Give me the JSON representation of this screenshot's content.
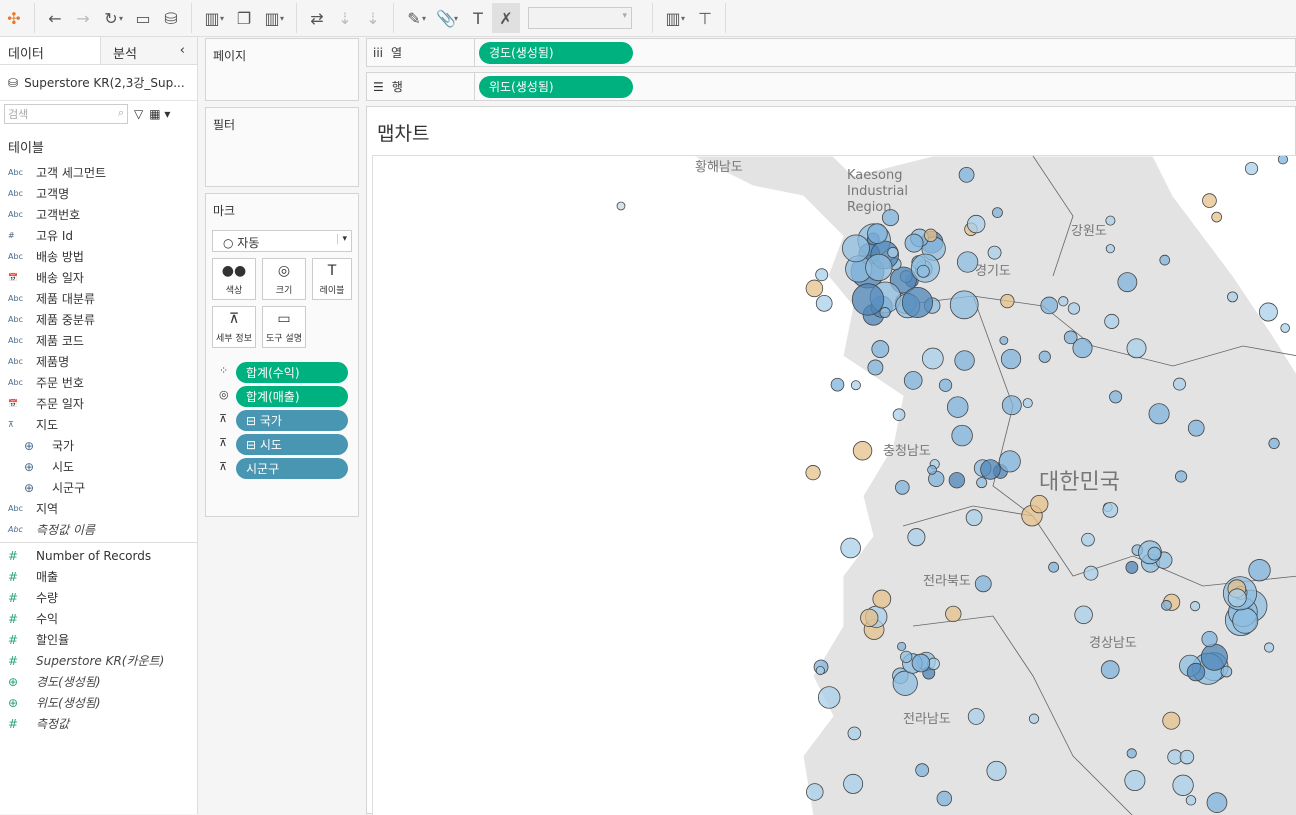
{
  "toolbar": {
    "icons": [
      "tableau-logo",
      "back",
      "forward",
      "redo",
      "save",
      "new-datasource",
      "new-worksheet",
      "duplicate-sheet",
      "clear-sheet",
      "swap",
      "sort-asc",
      "sort-desc",
      "highlight",
      "group",
      "show-labels",
      "fix-axes",
      "fit-dropdown",
      "show-me",
      "presentation"
    ],
    "fit_value": ""
  },
  "left": {
    "tab_data": "데이터",
    "tab_analysis": "분석",
    "datasource": "Superstore KR(2,3강_Sup...",
    "search_placeholder": "검색",
    "tables_header": "테이블",
    "dimensions": [
      {
        "type": "Abc",
        "label": "고객 세그먼트"
      },
      {
        "type": "Abc",
        "label": "고객명"
      },
      {
        "type": "Abc",
        "label": "고객번호"
      },
      {
        "type": "#",
        "label": "고유 Id"
      },
      {
        "type": "Abc",
        "label": "배송 방법"
      },
      {
        "type": "date",
        "label": "배송 일자"
      },
      {
        "type": "Abc",
        "label": "제품 대분류"
      },
      {
        "type": "Abc",
        "label": "제품 중분류"
      },
      {
        "type": "Abc",
        "label": "제품 코드"
      },
      {
        "type": "Abc",
        "label": "제품명"
      },
      {
        "type": "Abc",
        "label": "주문 번호"
      },
      {
        "type": "date",
        "label": "주문 일자"
      }
    ],
    "hierarchy": {
      "label": "지도",
      "children": [
        "국가",
        "시도",
        "시군구"
      ]
    },
    "after": [
      {
        "type": "Abc",
        "label": "지역"
      },
      {
        "type": "Abc",
        "label": "측정값 이름",
        "italic": true
      }
    ],
    "measures": [
      {
        "type": "#",
        "label": "Number of Records"
      },
      {
        "type": "#",
        "label": "매출"
      },
      {
        "type": "#",
        "label": "수량"
      },
      {
        "type": "#",
        "label": "수익"
      },
      {
        "type": "#",
        "label": "할인율"
      },
      {
        "type": "#",
        "label": "Superstore KR(카운트)",
        "italic": true
      },
      {
        "type": "geo",
        "label": "경도(생성됨)",
        "italic": true
      },
      {
        "type": "geo",
        "label": "위도(생성됨)",
        "italic": true
      },
      {
        "type": "#",
        "label": "측정값",
        "italic": true
      }
    ]
  },
  "pages": "페이지",
  "filters": "필터",
  "marks": {
    "title": "마크",
    "type": "자동",
    "buttons": [
      "색상",
      "크기",
      "레이블",
      "세부 정보",
      "도구 설명"
    ],
    "pills": [
      {
        "icon": "color",
        "label": "합계(수익)",
        "kind": "measure"
      },
      {
        "icon": "size",
        "label": "합계(매출)",
        "kind": "measure"
      },
      {
        "icon": "detail",
        "label": "⊟ 국가",
        "kind": "dimension"
      },
      {
        "icon": "detail",
        "label": "⊟ 시도",
        "kind": "dimension"
      },
      {
        "icon": "detail",
        "label": "시군구",
        "kind": "dimension"
      }
    ]
  },
  "columns": {
    "label": "열",
    "pill": "경도(생성됨)"
  },
  "rows": {
    "label": "행",
    "pill": "위도(생성됨)"
  },
  "view": {
    "title": "맵차트",
    "map_labels": [
      "황해남도",
      "Kaesong Industrial Region",
      "강원도",
      "경기도",
      "충청남도",
      "대한민국",
      "전라북도",
      "경상남도",
      "전라남도"
    ]
  },
  "colors": {
    "measure_pill": "#00b180",
    "dimension_pill": "#4996b2",
    "mark_blue": "#6fa8d6",
    "mark_orange": "#e6c08a"
  }
}
